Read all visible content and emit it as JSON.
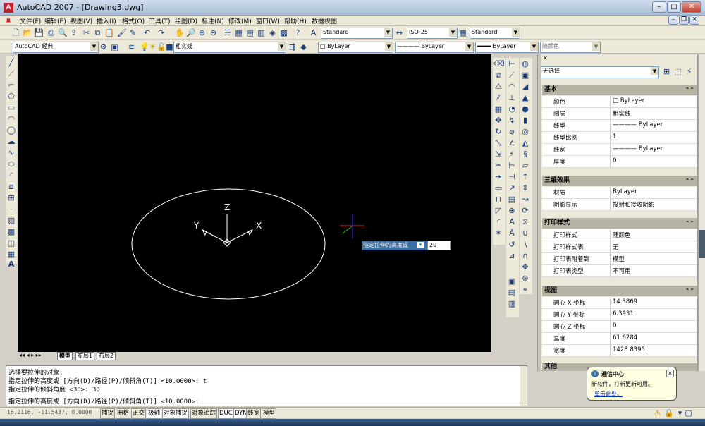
{
  "window": {
    "app_title": "AutoCAD 2007 - [Drawing3.dwg]",
    "app_icon": "A"
  },
  "menu": [
    "文件(F)",
    "编辑(E)",
    "视图(V)",
    "插入(I)",
    "格式(O)",
    "工具(T)",
    "绘图(D)",
    "标注(N)",
    "修改(M)",
    "窗口(W)",
    "帮助(H)",
    "数据视图"
  ],
  "toolbar": {
    "text_style": "Standard",
    "dim_style": "ISO-25",
    "table_style": "Standard",
    "workspace": "AutoCAD 经典",
    "layer": "粗实线",
    "color": "ByLayer",
    "linetype": "ByLayer",
    "lineweight": "ByLayer",
    "plotstyle": "随颜色"
  },
  "drawing": {
    "axis_z": "Z",
    "axis_y": "Y",
    "axis_x": "X",
    "dyn_prompt": "指定拉伸的高度或",
    "dyn_value": "20"
  },
  "layout_tabs": [
    "模型",
    "布局1",
    "布局2"
  ],
  "properties": {
    "selection": "无选择",
    "sections": {
      "basic": {
        "title": "基本",
        "rows": [
          {
            "label": "颜色",
            "value": "ByLayer"
          },
          {
            "label": "图层",
            "value": "粗实线"
          },
          {
            "label": "线型",
            "value": "———— ByLayer"
          },
          {
            "label": "线型比例",
            "value": "1"
          },
          {
            "label": "线宽",
            "value": "———— ByLayer"
          },
          {
            "label": "厚度",
            "value": "0"
          }
        ]
      },
      "effects3d": {
        "title": "三维效果",
        "rows": [
          {
            "label": "材质",
            "value": "ByLayer"
          },
          {
            "label": "阴影显示",
            "value": "投射和接收阴影"
          }
        ]
      },
      "plot": {
        "title": "打印样式",
        "rows": [
          {
            "label": "打印样式",
            "value": "随颜色"
          },
          {
            "label": "打印样式表",
            "value": "无"
          },
          {
            "label": "打印表附着到",
            "value": "模型"
          },
          {
            "label": "打印表类型",
            "value": "不可用"
          }
        ]
      },
      "view": {
        "title": "视图",
        "rows": [
          {
            "label": "圆心 X 坐标",
            "value": "14.3869"
          },
          {
            "label": "圆心 Y 坐标",
            "value": "6.3931"
          },
          {
            "label": "圆心 Z 坐标",
            "value": "0"
          },
          {
            "label": "高度",
            "value": "61.6284"
          },
          {
            "label": "宽度",
            "value": "1428.8395"
          }
        ]
      },
      "misc": {
        "title": "其他"
      }
    }
  },
  "command": {
    "lines": [
      "选择要拉伸的对象:",
      "指定拉伸的高度或 [方向(D)/路径(P)/倾斜角(T)] <10.0000>: t",
      "指定拉伸的倾斜角度 <30>: 30",
      "指定拉伸的高度或 [方向(D)/路径(P)/倾斜角(T)] <10.0000>:"
    ]
  },
  "status": {
    "coords": "16.2116, -11.5437, 0.0000",
    "buttons": [
      "捕捉",
      "栅格",
      "正交",
      "极轴",
      "对象捕捉",
      "对象追踪",
      "DUCS",
      "DYN",
      "线宽",
      "模型"
    ]
  },
  "balloon": {
    "title": "通信中心",
    "body": "新软件，打新更新可用。",
    "link": "单击此处。"
  },
  "colors": {
    "canvas": "#000000",
    "ellipse": "#ffffff",
    "ucs_red": "#ff2020",
    "ucs_green": "#20c020",
    "ucs_blue": "#3030ff"
  }
}
